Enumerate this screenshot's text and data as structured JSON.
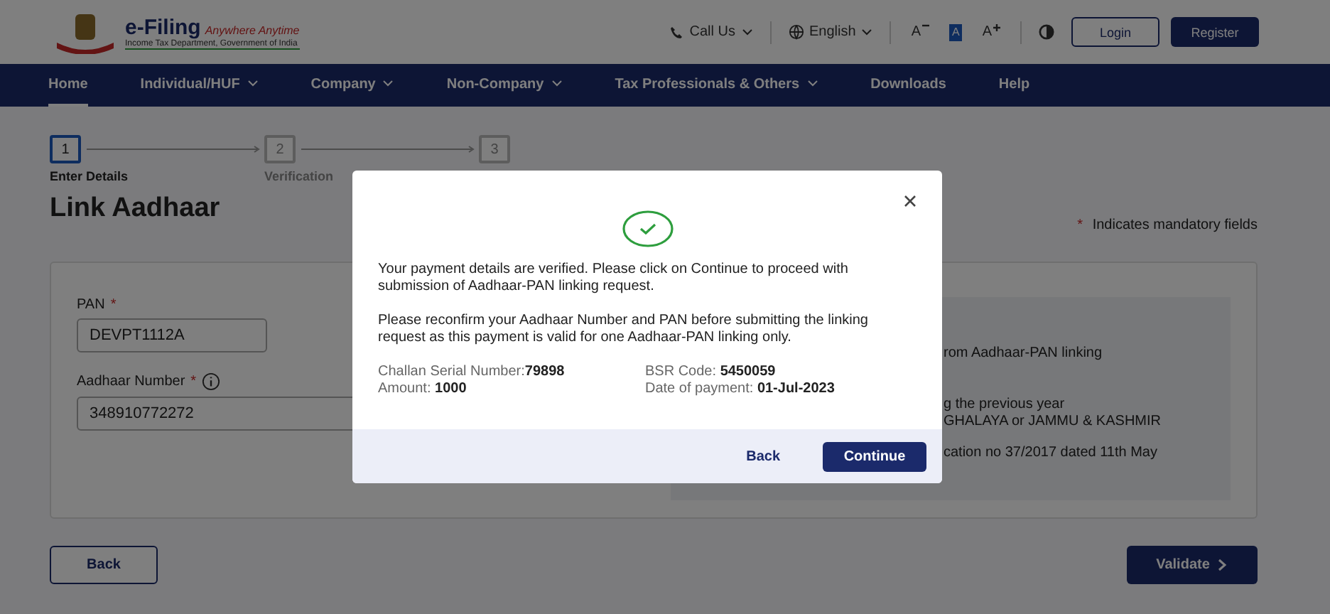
{
  "header": {
    "brand": "e-Filing",
    "tagline": "Anywhere Anytime",
    "subtitle": "Income Tax Department, Government of India",
    "call": "Call Us",
    "language": "English",
    "font_sizes": [
      {
        "label": "A",
        "kind": "decrease",
        "selected": false
      },
      {
        "label": "A",
        "kind": "normal",
        "selected": true
      },
      {
        "label": "A",
        "kind": "increase",
        "selected": false
      }
    ],
    "login": "Login",
    "register": "Register"
  },
  "nav": [
    {
      "label": "Home",
      "menu": false,
      "selected": true
    },
    {
      "label": "Individual/HUF",
      "menu": true,
      "selected": false
    },
    {
      "label": "Company",
      "menu": true,
      "selected": false
    },
    {
      "label": "Non-Company",
      "menu": true,
      "selected": false
    },
    {
      "label": "Tax Professionals & Others",
      "menu": true,
      "selected": false
    },
    {
      "label": "Downloads",
      "menu": false,
      "selected": false
    },
    {
      "label": "Help",
      "menu": false,
      "selected": false
    }
  ],
  "steps": [
    {
      "number": "1",
      "label": "Enter Details",
      "selected": true
    },
    {
      "number": "2",
      "label": "Verification",
      "selected": false
    },
    {
      "number": "3",
      "selected": false
    }
  ],
  "title": "Link Aadhaar",
  "mandatory_note": "Indicates mandatory fields",
  "required_mark": "*",
  "fields": [
    {
      "label": "PAN",
      "value": "DEVPT1112A",
      "info": false
    },
    {
      "label": "Aadhaar Number",
      "value": "348910772272",
      "info": true
    }
  ],
  "info_lines": [
    "rom Aadhaar-PAN linking",
    "g the previous year",
    "GHALAYA or JAMMU & KASHMIR",
    "cation no 37/2017 dated 11th May"
  ],
  "back": "Back",
  "validate": "Validate",
  "dialog": {
    "paragraphs": [
      "Your payment details are verified. Please click on Continue to proceed with submission of Aadhaar-PAN linking request.",
      "Please reconfirm your Aadhaar Number and PAN before submitting the linking request as this payment is valid for one Aadhaar-PAN linking only."
    ],
    "details": [
      "Challan Serial Number:**79898**",
      "BSR Code: **5450059**",
      "Amount: **1000**",
      "Date of payment: **01-Jul-2023**"
    ],
    "back": "Back",
    "continue": "Continue"
  }
}
